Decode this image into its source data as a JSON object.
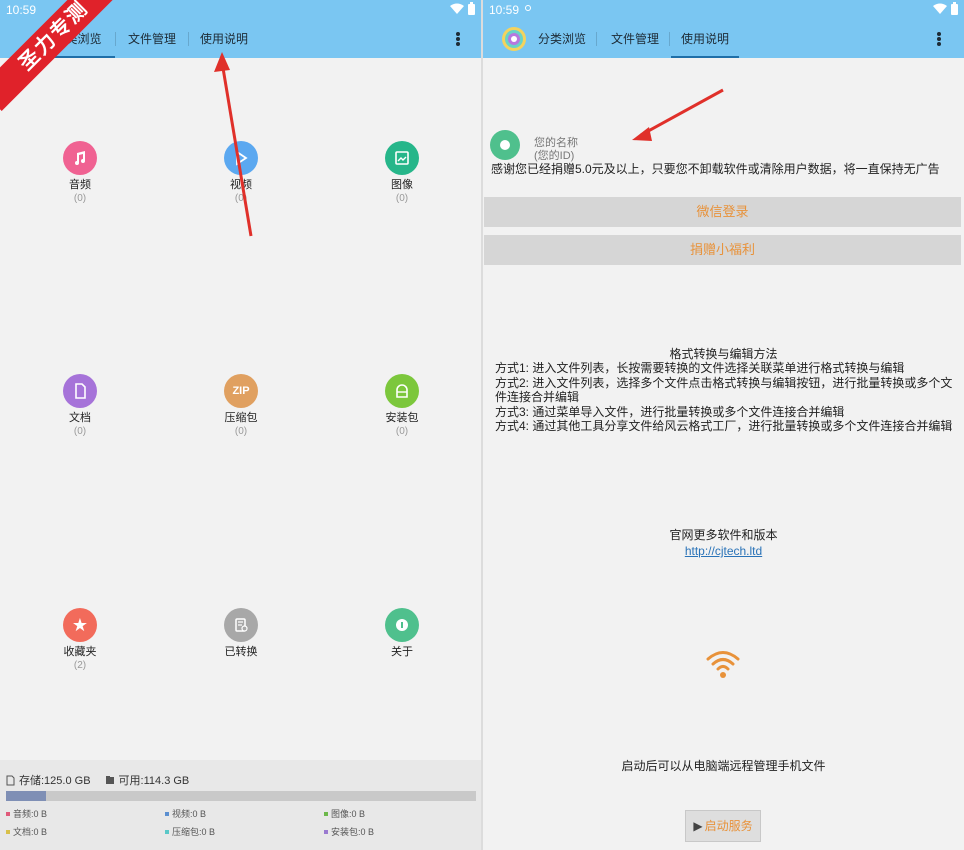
{
  "left": {
    "status_time": "10:59",
    "ribbon_text": "圣力专测",
    "tabs": [
      {
        "label": "分类浏览",
        "active": true
      },
      {
        "label": "文件管理",
        "active": false
      },
      {
        "label": "使用说明",
        "active": false
      }
    ],
    "categories": [
      {
        "label": "音频",
        "count": "(0)",
        "icon": "music-icon",
        "color": "#f06292"
      },
      {
        "label": "视频",
        "count": "(0)",
        "icon": "play-icon",
        "color": "#5ba8f0"
      },
      {
        "label": "图像",
        "count": "(0)",
        "icon": "image-icon",
        "color": "#26b68a"
      },
      {
        "label": "文档",
        "count": "(0)",
        "icon": "document-icon",
        "color": "#a673d9"
      },
      {
        "label": "压缩包",
        "count": "(0)",
        "icon": "zip-icon",
        "color": "#e0a060",
        "glyph": "ZIP"
      },
      {
        "label": "安装包",
        "count": "(0)",
        "icon": "android-icon",
        "color": "#7cc73c"
      },
      {
        "label": "收藏夹",
        "count": "(2)",
        "icon": "star-icon",
        "color": "#f26b5b"
      },
      {
        "label": "已转换",
        "count": "",
        "icon": "converted-icon",
        "color": "#a8a8a8"
      },
      {
        "label": "关于",
        "count": "",
        "icon": "info-icon",
        "color": "#4fc08d"
      }
    ],
    "storage": {
      "total_text": "存储:125.0 GB",
      "free_text": "可用:114.3 GB",
      "used_fraction": 0.085,
      "legend": [
        {
          "label": "音频:0 B",
          "color": "#e05a7a"
        },
        {
          "label": "视频:0 B",
          "color": "#5b8fd0"
        },
        {
          "label": "图像:0 B",
          "color": "#6cb84a"
        },
        {
          "label": "文档:0 B",
          "color": "#d8c04a"
        },
        {
          "label": "压缩包:0 B",
          "color": "#5ac8c8"
        },
        {
          "label": "安装包:0 B",
          "color": "#9a7ad0"
        }
      ]
    }
  },
  "right": {
    "status_time": "10:59",
    "tabs": [
      {
        "label": "分类浏览",
        "active": false
      },
      {
        "label": "文件管理",
        "active": false
      },
      {
        "label": "使用说明",
        "active": true
      }
    ],
    "user_name": "您的名称",
    "user_id": "(您的ID)",
    "thanks_text": "感谢您已经捐赠5.0元及以上，只要您不卸载软件或清除用户数据，将一直保持无广告",
    "wechat_login": "微信登录",
    "donate_button": "捐赠小福利",
    "methods_title": "格式转换与编辑方法",
    "methods": [
      "方式1: 进入文件列表，长按需要转换的文件选择关联菜单进行格式转换与编辑",
      "方式2: 进入文件列表，选择多个文件点击格式转换与编辑按钮，进行批量转换或多个文件连接合并编辑",
      "方式3: 通过菜单导入文件，进行批量转换或多个文件连接合并编辑",
      "方式4: 通过其他工具分享文件给风云格式工厂，进行批量转换或多个文件连接合并编辑"
    ],
    "website_title": "官网更多软件和版本",
    "website_link": "http://cjtech.ltd",
    "remote_text": "启动后可以从电脑端远程管理手机文件",
    "start_button": "启动服务",
    "accent_color": "#e8923a"
  }
}
